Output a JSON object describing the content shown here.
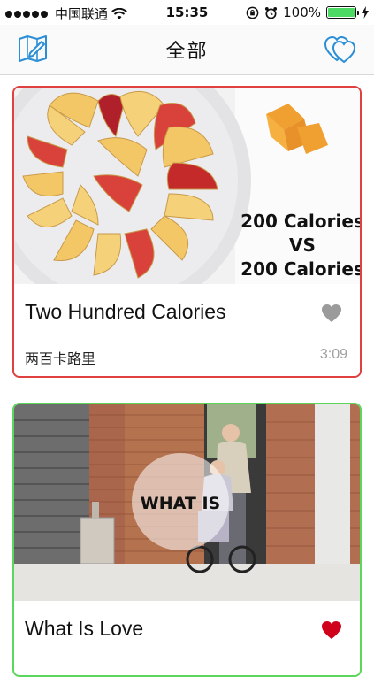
{
  "status_bar": {
    "carrier": "中国联通",
    "time": "15:35",
    "battery_percent": "100%"
  },
  "nav": {
    "title": "全部",
    "left_icon": "map-icon",
    "right_icon": "hearts-icon"
  },
  "videos": [
    {
      "thumbnail_text": [
        "200 Calories",
        "VS",
        "200 Calories"
      ],
      "title": "Two Hundred Calories",
      "subtitle": "两百卡路里",
      "duration": "3:09",
      "favorited": false,
      "border_color": "#e04040",
      "heart_color": "#9b9b9b"
    },
    {
      "thumbnail_text": [
        "WHAT IS"
      ],
      "title": "What Is Love",
      "favorited": true,
      "border_color": "#5cd65c",
      "heart_color": "#d0021b"
    }
  ]
}
